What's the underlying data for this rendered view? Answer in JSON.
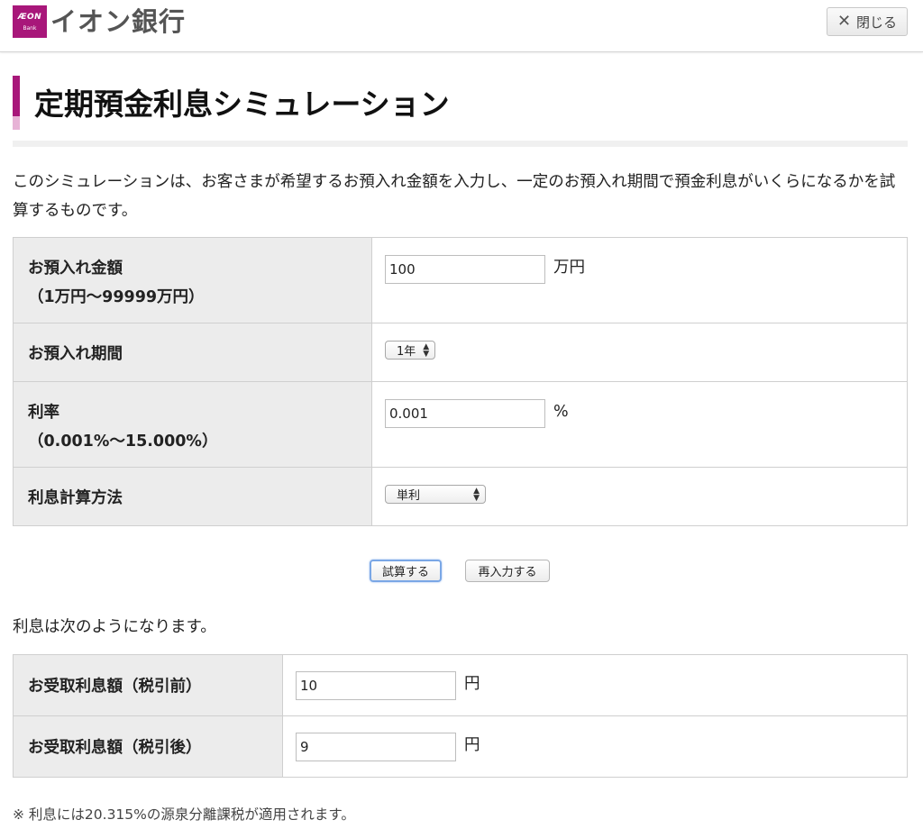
{
  "header": {
    "logo_mark_top": "ÆON",
    "logo_mark_bottom": "Bank",
    "logo_text": "イオン銀行",
    "close_label": "閉じる",
    "brand_color": "#a8177a"
  },
  "page_title": "定期預金利息シミュレーション",
  "intro": "このシミュレーションは、お客さまが希望するお預入れ金額を入力し、一定のお預入れ期間で預金利息がいくらになるかを試算するものです。",
  "form": {
    "amount": {
      "label": "お預入れ金額",
      "sublabel": "（1万円〜99999万円）",
      "value": "100",
      "unit": "万円"
    },
    "period": {
      "label": "お預入れ期間",
      "selected": "1年"
    },
    "rate": {
      "label": "利率",
      "sublabel": "（0.001%〜15.000%）",
      "value": "0.001",
      "unit": "%"
    },
    "method": {
      "label": "利息計算方法",
      "selected": "単利"
    }
  },
  "buttons": {
    "calculate": "試算する",
    "reset": "再入力する"
  },
  "result_intro": "利息は次のようになります。",
  "results": {
    "before_tax": {
      "label": "お受取利息額（税引前）",
      "value": "10",
      "unit": "円"
    },
    "after_tax": {
      "label": "お受取利息額（税引後）",
      "value": "9",
      "unit": "円"
    }
  },
  "note": "※ 利息には20.315%の源泉分離課税が適用されます。"
}
